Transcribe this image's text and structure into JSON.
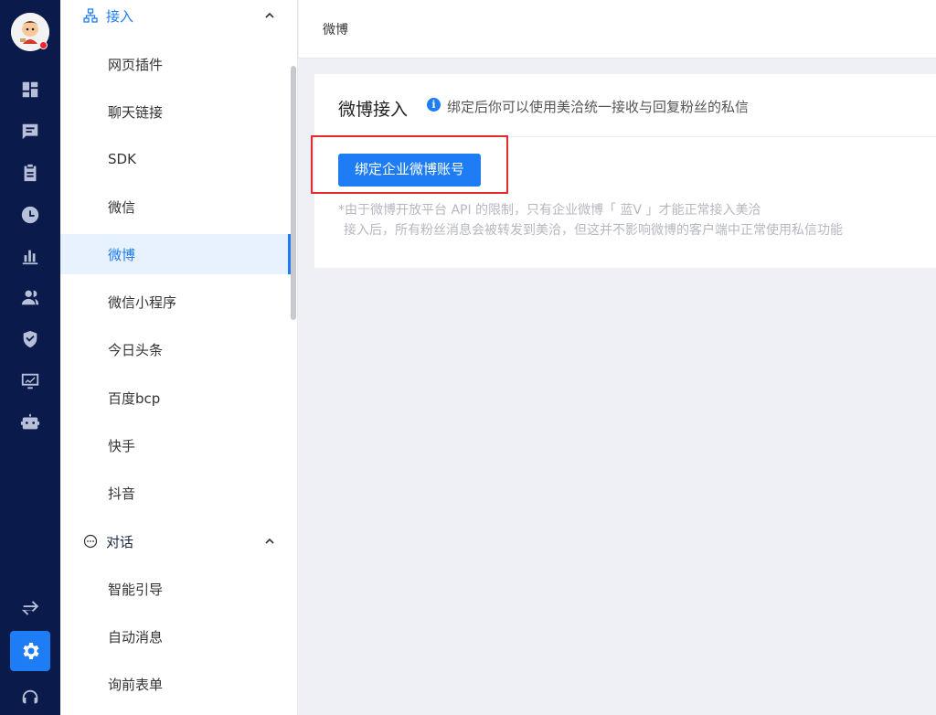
{
  "rail": {
    "icons": [
      "dashboard-icon",
      "chat-icon",
      "clipboard-icon",
      "clock-icon",
      "bar-chart-icon",
      "users-icon",
      "shield-icon",
      "monitor-icon",
      "robot-icon",
      "swap-icon",
      "settings-icon",
      "support-icon"
    ],
    "active": "settings-icon"
  },
  "sidebar": {
    "group_access": {
      "label": "接入",
      "icon": "network-icon"
    },
    "items_access": [
      "网页插件",
      "聊天链接",
      "SDK",
      "微信",
      "微博",
      "微信小程序",
      "今日头条",
      "百度bcp",
      "快手",
      "抖音"
    ],
    "active_item": "微博",
    "group_chat": {
      "label": "对话",
      "icon": "chat-bubble-icon"
    },
    "items_chat": [
      "智能引导",
      "自动消息",
      "询前表单"
    ]
  },
  "header": {
    "breadcrumb": "微博"
  },
  "card": {
    "title": "微博接入",
    "hint": "绑定后你可以使用美洽统一接收与回复粉丝的私信",
    "bind_button": "绑定企业微博账号",
    "note_line1": "*由于微博开放平台 API 的限制，只有企业微博「 蓝V 」才能正常接入美洽",
    "note_line2": "接入后，所有粉丝消息会被转发到美洽，但这并不影响微博的客户端中正常使用私信功能"
  },
  "colors": {
    "rail_bg": "#0a1a4a",
    "accent": "#1e7cf5",
    "highlight": "#e7282d"
  }
}
